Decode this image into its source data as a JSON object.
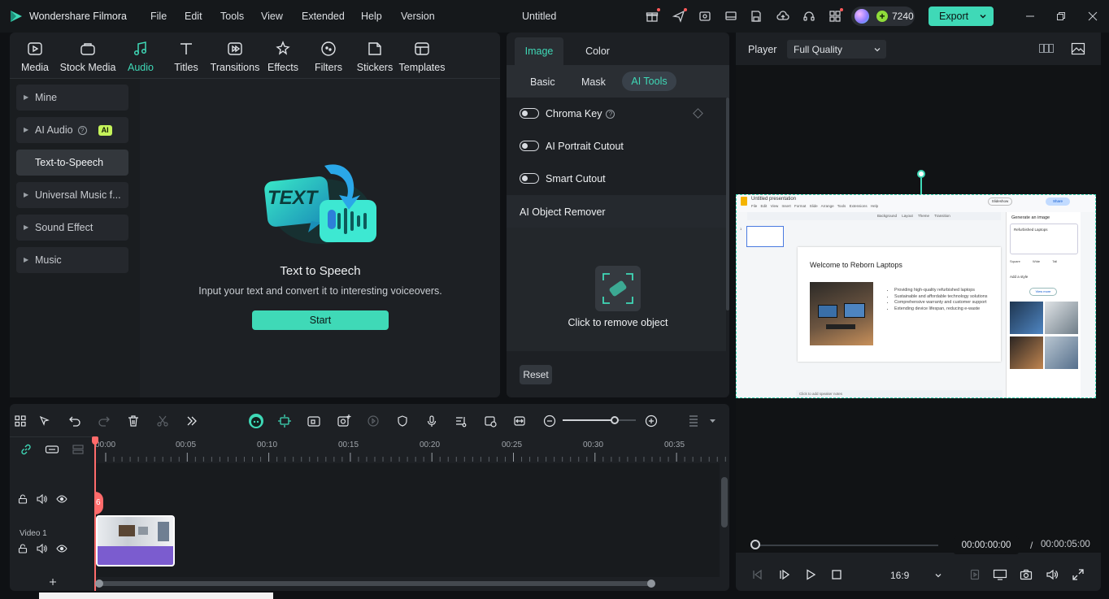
{
  "app": {
    "name": "Wondershare Filmora",
    "doc_title": "Untitled",
    "credits": "7240",
    "export_label": "Export"
  },
  "menu": [
    "File",
    "Edit",
    "Tools",
    "View",
    "Extended",
    "Help",
    "Version"
  ],
  "library": {
    "tabs": [
      {
        "label": "Media",
        "icon": "media-icon"
      },
      {
        "label": "Stock Media",
        "icon": "stock-media-icon"
      },
      {
        "label": "Audio",
        "icon": "audio-icon",
        "active": true
      },
      {
        "label": "Titles",
        "icon": "titles-icon"
      },
      {
        "label": "Transitions",
        "icon": "transitions-icon"
      },
      {
        "label": "Effects",
        "icon": "effects-icon"
      },
      {
        "label": "Filters",
        "icon": "filters-icon"
      },
      {
        "label": "Stickers",
        "icon": "stickers-icon"
      },
      {
        "label": "Templates",
        "icon": "templates-icon"
      }
    ],
    "sidebar": [
      {
        "label": "Mine"
      },
      {
        "label": "AI Audio",
        "badge": "AI"
      },
      {
        "label": "Text-to-Speech",
        "active": true
      },
      {
        "label": "Universal Music f..."
      },
      {
        "label": "Sound Effect"
      },
      {
        "label": "Music"
      }
    ],
    "tts": {
      "art_text": "TEXT",
      "title": "Text to Speech",
      "description": "Input your text and convert it to interesting voiceovers.",
      "start_label": "Start"
    }
  },
  "properties": {
    "tabs": [
      "Image",
      "Color"
    ],
    "subtabs": [
      "Basic",
      "Mask",
      "AI Tools"
    ],
    "toggles": [
      {
        "label": "Chroma Key"
      },
      {
        "label": "AI Portrait Cutout"
      },
      {
        "label": "Smart Cutout"
      }
    ],
    "object_remover_title": "AI Object Remover",
    "remove_label": "Click to remove object",
    "reset_label": "Reset"
  },
  "player": {
    "label": "Player",
    "quality": "Full Quality",
    "current_time": "00:00:00:00",
    "total_time": "00:00:05:00",
    "separator": "/",
    "aspect": "16:9"
  },
  "slide": {
    "doc_title": "Untitled presentation",
    "menu": [
      "File",
      "Edit",
      "View",
      "Insert",
      "Format",
      "Slide",
      "Arrange",
      "Tools",
      "Extensions",
      "Help"
    ],
    "toolbar_tabs": [
      "Background",
      "Layout",
      "Theme",
      "Transition"
    ],
    "slideshow_label": "Slideshow",
    "share_label": "Share",
    "slide_number": "1",
    "heading": "Welcome to Reborn Laptops",
    "bullets": [
      "Providing high-quality refurbished laptops",
      "Sustainable and affordable technology solutions",
      "Comprehensive warranty and customer support",
      "Extending device lifespan, reducing e-waste"
    ],
    "notes_placeholder": "Click to add speaker notes",
    "gen_panel": {
      "title": "Generate an image",
      "prompt": "Refurbished Laptops",
      "shapes": [
        "Square",
        "Wide",
        "Tall"
      ],
      "style_label": "Add a style",
      "view_more": "View more"
    }
  },
  "timeline": {
    "ticks": [
      "00:00",
      "00:05",
      "00:10",
      "00:15",
      "00:20",
      "00:25",
      "00:30",
      "00:35"
    ],
    "track_label": "Video 1",
    "zoom_level": 0.72,
    "playhead_marker": "6"
  },
  "colors": {
    "accent": "#3fd9b7",
    "bg": "#0f1114",
    "panel": "#1d2024",
    "clip": "#7b5ccf"
  }
}
